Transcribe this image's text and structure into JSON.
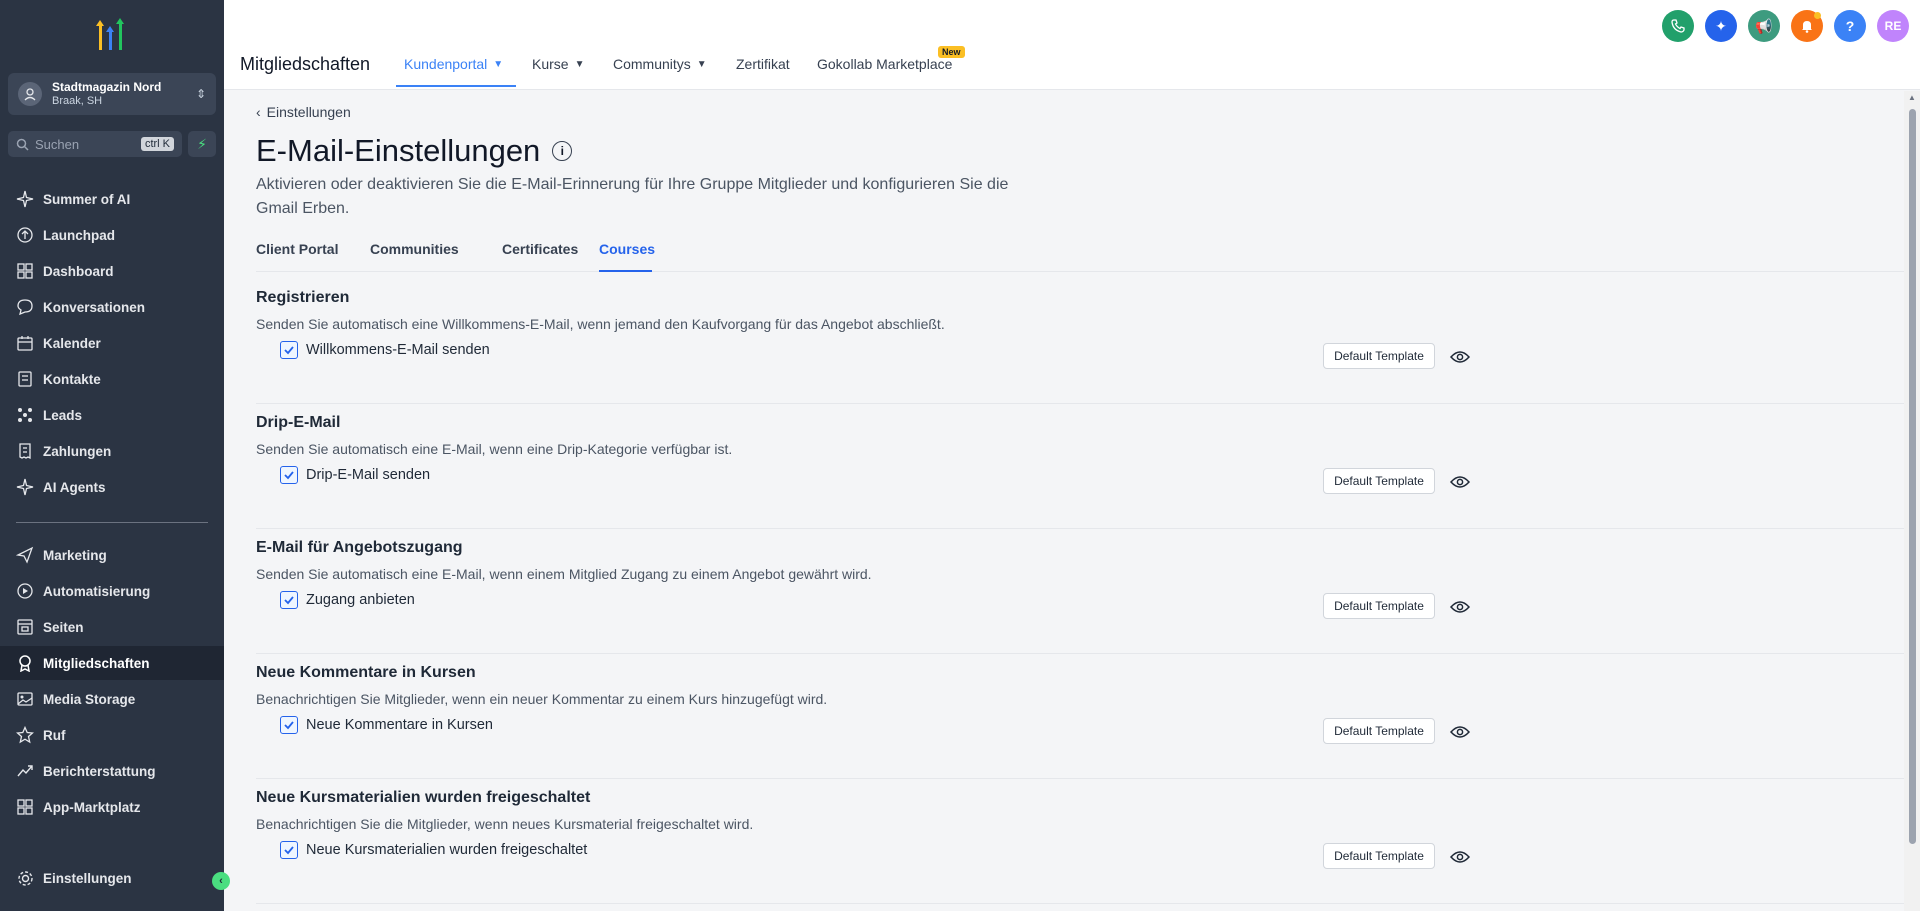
{
  "sidebar": {
    "account": {
      "name": "Stadtmagazin Nord",
      "location": "Braak, SH"
    },
    "search": {
      "placeholder": "Suchen",
      "shortcut": "ctrl K"
    },
    "items": [
      {
        "label": "Summer of AI",
        "icon": "sparkle-icon"
      },
      {
        "label": "Launchpad",
        "icon": "rocket-icon"
      },
      {
        "label": "Dashboard",
        "icon": "grid-icon"
      },
      {
        "label": "Konversationen",
        "icon": "chat-icon"
      },
      {
        "label": "Kalender",
        "icon": "calendar-icon"
      },
      {
        "label": "Kontakte",
        "icon": "contacts-icon"
      },
      {
        "label": "Leads",
        "icon": "leads-icon"
      },
      {
        "label": "Zahlungen",
        "icon": "receipt-icon"
      },
      {
        "label": "AI Agents",
        "icon": "sparkle-icon"
      }
    ],
    "items2": [
      {
        "label": "Marketing",
        "icon": "send-icon"
      },
      {
        "label": "Automatisierung",
        "icon": "automation-icon"
      },
      {
        "label": "Seiten",
        "icon": "page-icon"
      },
      {
        "label": "Mitgliedschaften",
        "icon": "award-icon",
        "active": true
      },
      {
        "label": "Media Storage",
        "icon": "image-icon"
      },
      {
        "label": "Ruf",
        "icon": "star-icon"
      },
      {
        "label": "Berichterstattung",
        "icon": "trend-icon"
      },
      {
        "label": "App-Marktplatz",
        "icon": "apps-icon"
      }
    ],
    "settings": "Einstellungen"
  },
  "header": {
    "title": "Mitgliedschaften",
    "tabs": [
      {
        "label": "Kundenportal",
        "active": true,
        "dropdown": true
      },
      {
        "label": "Kurse",
        "dropdown": true
      },
      {
        "label": "Communitys",
        "dropdown": true
      },
      {
        "label": "Zertifikat"
      },
      {
        "label": "Gokollab Marketplace",
        "badge": "New"
      }
    ],
    "avatar_initials": "RE"
  },
  "main": {
    "back_label": "Einstellungen",
    "title": "E-Mail-Einstellungen",
    "description": "Aktivieren oder deaktivieren Sie die E-Mail-Erinnerung für Ihre Gruppe Mitglieder und konfigurieren Sie die Gmail Erben.",
    "tabs": [
      "Client Portal",
      "Communities",
      "Certificates",
      "Courses"
    ],
    "active_tab": "Courses",
    "template_label": "Default Template",
    "sections": [
      {
        "title": "Registrieren",
        "desc": "Senden Sie automatisch eine Willkommens-E-Mail, wenn jemand den Kaufvorgang für das Angebot abschließt.",
        "check": "Willkommens-E-Mail senden",
        "checked": true
      },
      {
        "title": "Drip-E-Mail",
        "desc": "Senden Sie automatisch eine E-Mail, wenn eine Drip-Kategorie verfügbar ist.",
        "check": "Drip-E-Mail senden",
        "checked": true
      },
      {
        "title": "E-Mail für Angebotszugang",
        "desc": "Senden Sie automatisch eine E-Mail, wenn einem Mitglied Zugang zu einem Angebot gewährt wird.",
        "check": "Zugang anbieten",
        "checked": true
      },
      {
        "title": "Neue Kommentare in Kursen",
        "desc": "Benachrichtigen Sie Mitglieder, wenn ein neuer Kommentar zu einem Kurs hinzugefügt wird.",
        "check": "Neue Kommentare in Kursen",
        "checked": true
      },
      {
        "title": "Neue Kursmaterialien wurden freigeschaltet",
        "desc": "Benachrichtigen Sie die Mitglieder, wenn neues Kursmaterial freigeschaltet wird.",
        "check": "Neue Kursmaterialien wurden freigeschaltet",
        "checked": true
      }
    ]
  },
  "colors": {
    "sidebar_bg": "#2b3443",
    "accent": "#3b82f6",
    "checkbox": "#2563eb"
  }
}
